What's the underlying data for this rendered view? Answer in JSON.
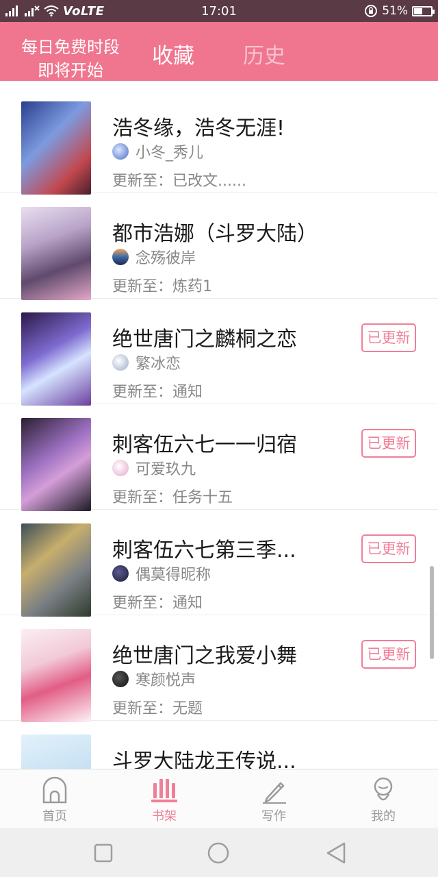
{
  "status_bar": {
    "signal_left": "4G",
    "volte": "VoLTE",
    "time": "17:01",
    "battery_percent": "51%",
    "battery_level": 0.51
  },
  "header": {
    "promo_line1": "每日免费时段",
    "promo_line2": "即将开始",
    "tab_favorites": "收藏",
    "tab_history": "历史",
    "accent_color": "#f0758f"
  },
  "books": [
    {
      "title": "浩冬缘，浩冬无涯!",
      "author": "小冬_秀儿",
      "update": "更新至：已改文......",
      "badge": ""
    },
    {
      "title": "都市浩娜（斗罗大陆）",
      "author": "念殇彼岸",
      "update": "更新至：炼药1",
      "badge": ""
    },
    {
      "title": "绝世唐门之麟桐之恋",
      "author": "繁冰恋",
      "update": "更新至：通知",
      "badge": "已更新"
    },
    {
      "title": "刺客伍六七一一归宿",
      "author": "可爱玖九",
      "update": "更新至：任务十五",
      "badge": "已更新"
    },
    {
      "title": "刺客伍六七第三季...",
      "author": "偶莫得昵称",
      "update": "更新至：通知",
      "badge": "已更新"
    },
    {
      "title": "绝世唐门之我爱小舞",
      "author": "寒颜悦声",
      "update": "更新至：无题",
      "badge": "已更新"
    },
    {
      "title": "斗罗大陆龙王传说...",
      "author": "",
      "update": "",
      "badge": ""
    }
  ],
  "bottom_tabs": {
    "home": "首页",
    "bookshelf": "书架",
    "write": "写作",
    "mine": "我的",
    "active": "bookshelf"
  },
  "icons": {
    "home": "home-arch-icon",
    "bookshelf": "bookshelf-bars-icon",
    "write": "pencil-icon",
    "mine": "profile-icon",
    "nav_recent": "square-icon",
    "nav_home": "circle-icon",
    "nav_back": "triangle-back-icon"
  }
}
